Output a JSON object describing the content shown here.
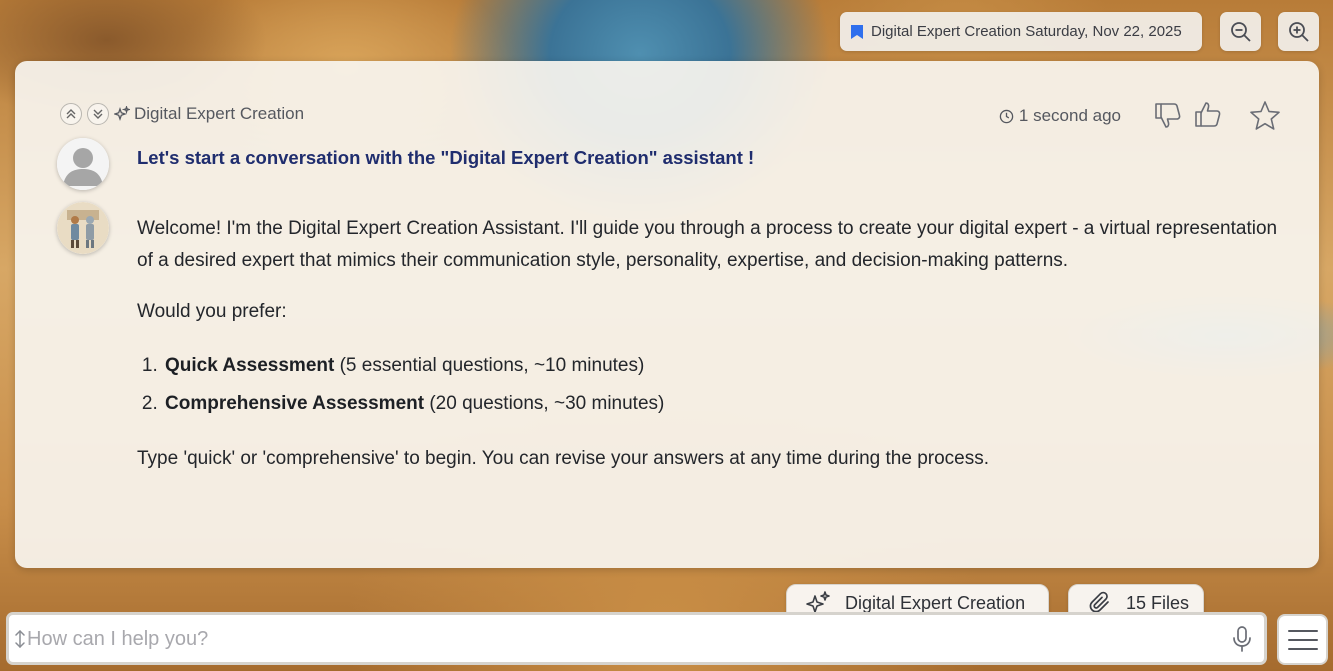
{
  "topbar": {
    "chip_label": "Digital Expert Creation Saturday, Nov 22, 2025"
  },
  "conversation": {
    "assistant_name": "Digital Expert Creation",
    "timestamp": "1 second ago",
    "intro": "Let's start a conversation with the \"Digital Expert Creation\" assistant !",
    "message": {
      "paragraph1": "Welcome! I'm the Digital Expert Creation Assistant. I'll guide you through a process to create your digital expert - a virtual representation of a desired expert that mimics their communication style, personality, expertise, and decision-making patterns.",
      "paragraph2": "Would you prefer:",
      "options": [
        {
          "title": "Quick Assessment",
          "detail": " (5 essential questions, ~10 minutes)"
        },
        {
          "title": "Comprehensive Assessment",
          "detail": " (20 questions, ~30 minutes)"
        }
      ],
      "paragraph3": "Type 'quick' or 'comprehensive' to begin. You can revise your answers at any time during the process."
    }
  },
  "footer": {
    "assistant_chip": "Digital Expert Creation",
    "files_chip": "15 Files",
    "input_placeholder": "How can I help you?"
  },
  "colors": {
    "accent": "#2f6fed",
    "intro_text": "#1f2d6e"
  }
}
